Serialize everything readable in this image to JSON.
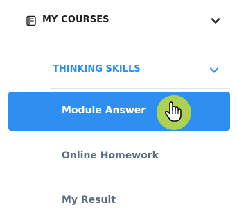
{
  "menu": {
    "section_title": "MY COURSES",
    "section_icon": "book-icon",
    "section_chevron": "chevron-down-icon",
    "group": {
      "title": "THINKING SKILLS",
      "chevron": "chevron-down-icon",
      "accent_color": "#2f8ff0",
      "items": [
        {
          "label": "Module Answer",
          "active": true
        },
        {
          "label": "Online Homework",
          "active": false
        },
        {
          "label": "My Result",
          "active": false
        }
      ]
    }
  },
  "cursor": {
    "icon": "hand-pointer-icon",
    "highlight_color": "#b5d44a"
  }
}
